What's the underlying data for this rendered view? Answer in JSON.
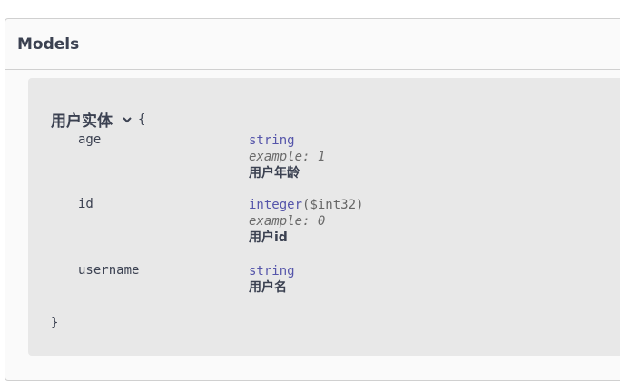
{
  "models": {
    "title": "Models",
    "model": {
      "name": "用户实体",
      "toggle_icon": "chevron-down-icon",
      "open_brace": "{",
      "close_brace": "}",
      "properties": [
        {
          "name": "age",
          "type": "string",
          "format": "",
          "example_label": "example:",
          "example_value": "1",
          "description": "用户年龄"
        },
        {
          "name": "id",
          "type": "integer",
          "format": "($int32)",
          "example_label": "example:",
          "example_value": "0",
          "description": "用户id"
        },
        {
          "name": "username",
          "type": "string",
          "format": "",
          "example_label": "",
          "example_value": "",
          "description": "用户名"
        }
      ]
    }
  }
}
